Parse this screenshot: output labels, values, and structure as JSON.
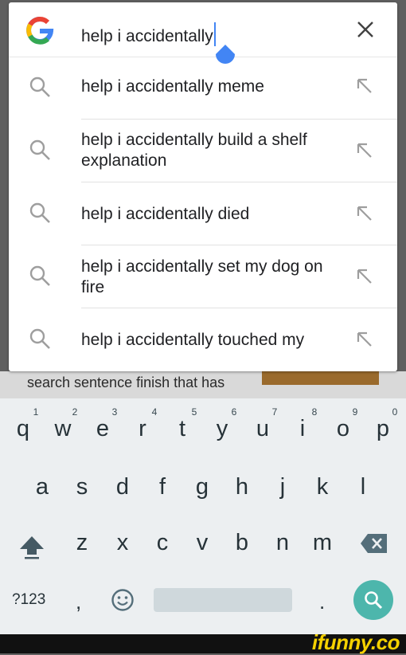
{
  "search": {
    "query": "help i accidentally",
    "clear_icon": "close-icon"
  },
  "suggestions": [
    {
      "text": "help i accidentally meme"
    },
    {
      "text": "help i accidentally build a shelf explanation"
    },
    {
      "text": "help i accidentally died"
    },
    {
      "text": "help i accidentally set my dog on fire"
    },
    {
      "text": "help i accidentally touched my"
    }
  ],
  "background": {
    "caption": "search sentence finish that has"
  },
  "keyboard": {
    "row1": [
      "q",
      "w",
      "e",
      "r",
      "t",
      "y",
      "u",
      "i",
      "o",
      "p"
    ],
    "row1_hints": [
      "1",
      "2",
      "3",
      "4",
      "5",
      "6",
      "7",
      "8",
      "9",
      "0"
    ],
    "row2": [
      "a",
      "s",
      "d",
      "f",
      "g",
      "h",
      "j",
      "k",
      "l"
    ],
    "row3": [
      "z",
      "x",
      "c",
      "v",
      "b",
      "n",
      "m"
    ],
    "symbols_label": "?123",
    "comma": ",",
    "period": ".",
    "search_key_color": "#4db6ac"
  },
  "watermark": "ifunny.co",
  "colors": {
    "accent": "#4285f4",
    "text": "#202124",
    "icon_gray": "#9e9e9e"
  }
}
